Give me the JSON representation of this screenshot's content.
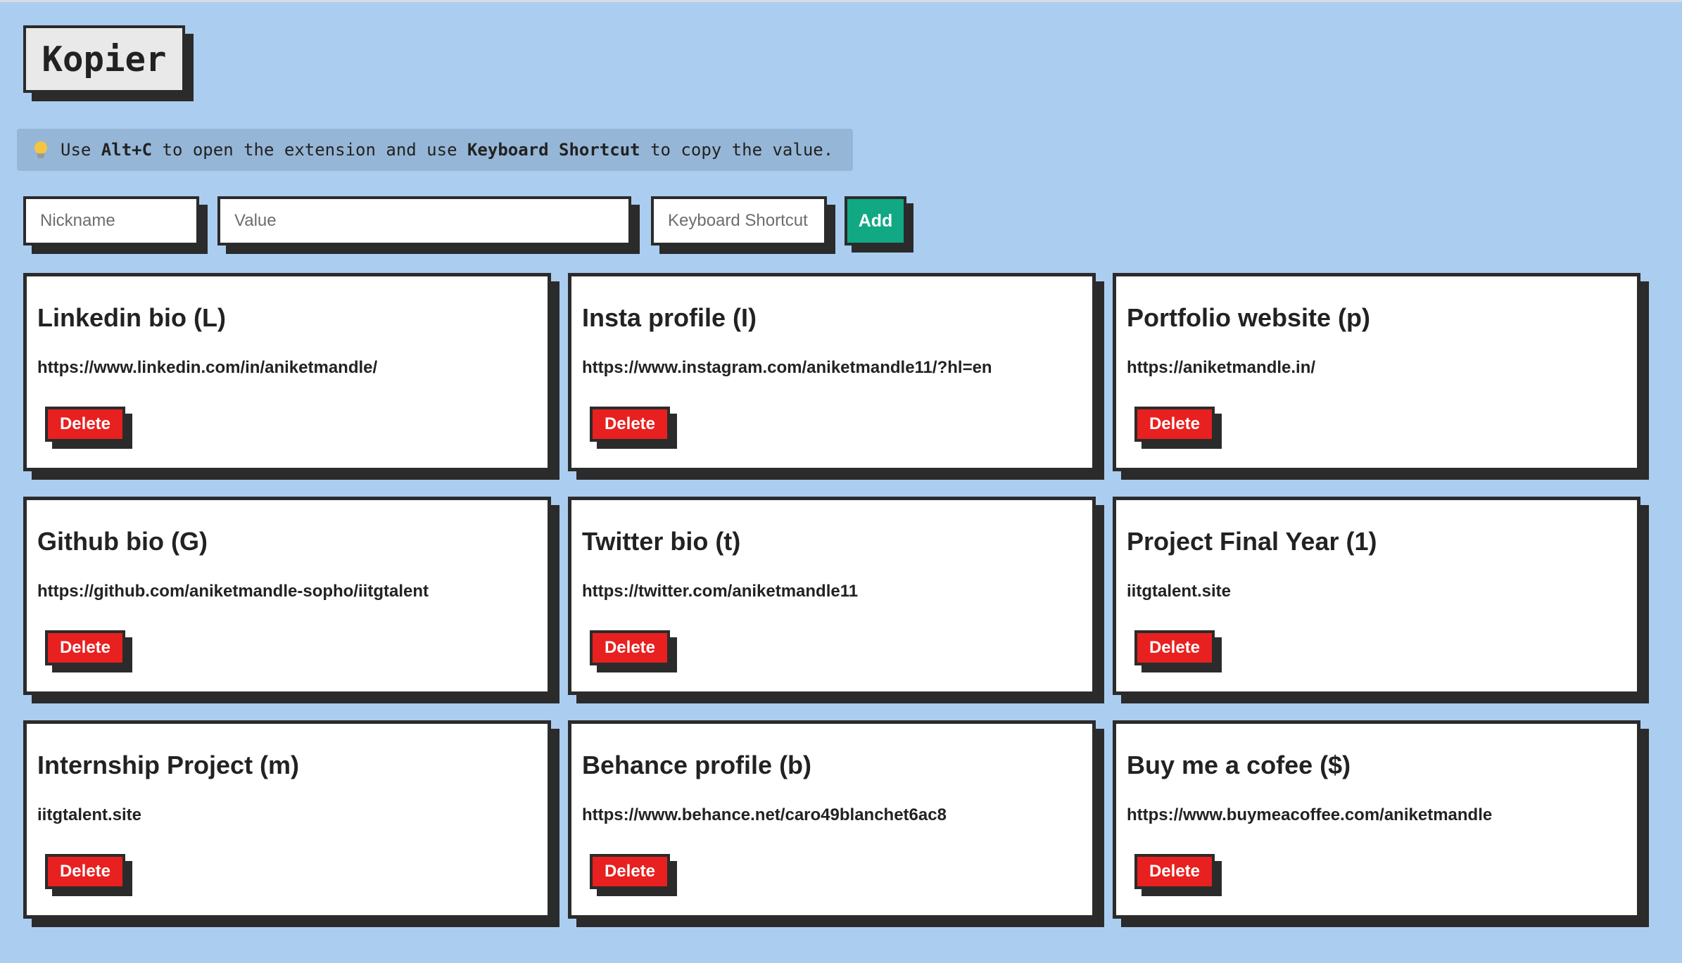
{
  "app": {
    "title": "Kopier"
  },
  "hint": {
    "icon": "lightbulb-icon",
    "prefix": "Use ",
    "key1": "Alt+C",
    "middle": " to open the extension and use ",
    "key2": "Keyboard Shortcut",
    "suffix": " to copy the value."
  },
  "form": {
    "nickname_placeholder": "Nickname",
    "value_placeholder": "Value",
    "shortcut_placeholder": "Keyboard Shortcut",
    "add_label": "Add"
  },
  "colors": {
    "background": "#abcdf0",
    "add_button": "#11a884",
    "delete_button": "#e8201f",
    "border": "#2b2b2b"
  },
  "cards": [
    {
      "title": "Linkedin bio (L)",
      "value": "https://www.linkedin.com/in/aniketmandle/",
      "delete_label": "Delete"
    },
    {
      "title": "Insta profile (I)",
      "value": "https://www.instagram.com/aniketmandle11/?hl=en",
      "delete_label": "Delete"
    },
    {
      "title": "Portfolio website (p)",
      "value": "https://aniketmandle.in/",
      "delete_label": "Delete"
    },
    {
      "title": "Github bio (G)",
      "value": "https://github.com/aniketmandle-sopho/iitgtalent",
      "delete_label": "Delete"
    },
    {
      "title": "Twitter bio (t)",
      "value": "https://twitter.com/aniketmandle11",
      "delete_label": "Delete"
    },
    {
      "title": "Project Final Year (1)",
      "value": "iitgtalent.site",
      "delete_label": "Delete"
    },
    {
      "title": "Internship Project (m)",
      "value": "iitgtalent.site",
      "delete_label": "Delete"
    },
    {
      "title": "Behance profile (b)",
      "value": "https://www.behance.net/caro49blanchet6ac8",
      "delete_label": "Delete"
    },
    {
      "title": "Buy me a cofee ($)",
      "value": "https://www.buymeacoffee.com/aniketmandle",
      "delete_label": "Delete"
    }
  ]
}
